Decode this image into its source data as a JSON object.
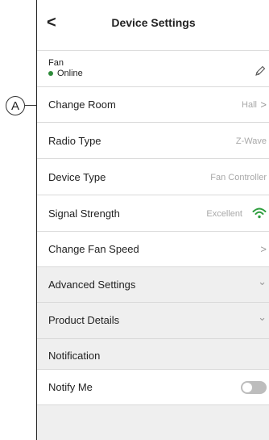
{
  "annotation": {
    "marker": "A"
  },
  "header": {
    "back_label": "<",
    "title": "Device Settings"
  },
  "device": {
    "name": "Fan",
    "status": "Online",
    "status_color": "#2e8b3a"
  },
  "rows": {
    "change_room": {
      "label": "Change Room",
      "value": "Hall"
    },
    "radio_type": {
      "label": "Radio Type",
      "value": "Z-Wave"
    },
    "device_type": {
      "label": "Device Type",
      "value": "Fan Controller"
    },
    "signal_strength": {
      "label": "Signal Strength",
      "value": "Excellent",
      "icon": "wifi-icon",
      "icon_color": "#2e9e3e"
    },
    "change_fan_speed": {
      "label": "Change Fan Speed"
    },
    "advanced_settings": {
      "label": "Advanced Settings"
    },
    "product_details": {
      "label": "Product Details"
    },
    "notification": {
      "label": "Notification"
    },
    "notify_me": {
      "label": "Notify Me",
      "enabled": false
    }
  },
  "glyphs": {
    "chevron_right": ">",
    "chevron_down": "⌄"
  }
}
